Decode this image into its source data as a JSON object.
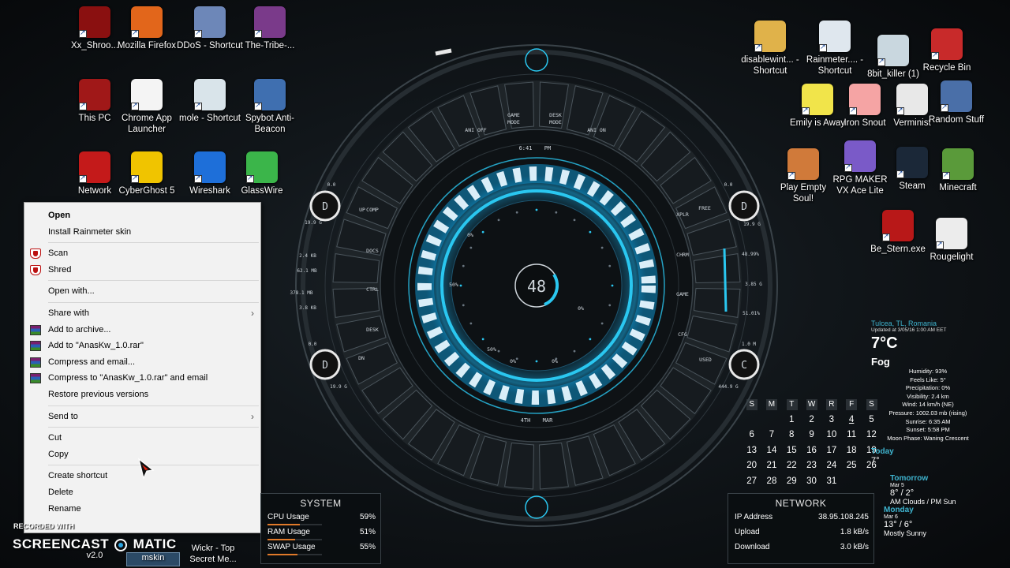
{
  "desktop_left": [
    {
      "label": "Xx_Shroo...",
      "color": "#8a1010"
    },
    {
      "label": "Mozilla Firefox",
      "color": "#e2661b"
    },
    {
      "label": "DDoS - Shortcut",
      "color": "#6d87b8"
    },
    {
      "label": "The-Tribe-...",
      "color": "#7a3a8a"
    },
    {
      "label": "This PC",
      "color": "#a01818"
    },
    {
      "label": "Chrome App Launcher",
      "color": "#f4f4f4"
    },
    {
      "label": "mole - Shortcut",
      "color": "#d9e4ea"
    },
    {
      "label": "Spybot Anti-Beacon",
      "color": "#3f6fb0"
    },
    {
      "label": "Network",
      "color": "#c41a1a"
    },
    {
      "label": "CyberGhost 5",
      "color": "#f0c400"
    },
    {
      "label": "Wireshark",
      "color": "#1e6fd9"
    },
    {
      "label": "GlassWire",
      "color": "#3bb54a"
    }
  ],
  "desktop_right": [
    {
      "label": "disablewint... - Shortcut",
      "color": "#e0b24a"
    },
    {
      "label": "Rainmeter.... - Shortcut",
      "color": "#dfe7ee"
    },
    {
      "label": "8bit_killer (1)",
      "color": "#c9d7df"
    },
    {
      "label": "Recycle Bin",
      "color": "#c82a2a"
    },
    {
      "label": "Emily is Away",
      "color": "#f1e44a"
    },
    {
      "label": "Iron Snout",
      "color": "#f5a4a4"
    },
    {
      "label": "Verminist",
      "color": "#e8e8e8"
    },
    {
      "label": "Random Stuff",
      "color": "#4a6fa8"
    },
    {
      "label": "Play Empty Soul!",
      "color": "#d07a3a"
    },
    {
      "label": "RPG MAKER VX Ace Lite",
      "color": "#7a5ac8"
    },
    {
      "label": "Steam",
      "color": "#1b2838"
    },
    {
      "label": "Minecraft",
      "color": "#5a9a3a"
    },
    {
      "label": "Be_Stern.exe",
      "color": "#b81818"
    },
    {
      "label": "Rougelight",
      "color": "#ececec"
    }
  ],
  "context_menu": {
    "open": "Open",
    "install_skin": "Install Rainmeter skin",
    "scan": "Scan",
    "shred": "Shred",
    "open_with": "Open with...",
    "share_with": "Share with",
    "add_archive": "Add to archive...",
    "add_rar": "Add to \"AnasKw_1.0.rar\"",
    "compress_email": "Compress and email...",
    "compress_rar_email": "Compress to \"AnasKw_1.0.rar\" and email",
    "restore": "Restore previous versions",
    "send_to": "Send to",
    "cut": "Cut",
    "copy": "Copy",
    "create_shortcut": "Create shortcut",
    "delete": "Delete",
    "rename": "Rename"
  },
  "hud": {
    "center_value": "48",
    "time": "6:41",
    "ampm": "PM",
    "date_day": "4TH",
    "date_month": "MAR",
    "top_buttons": [
      "ANI OFF",
      "GAME MODE",
      "DESK MODE",
      "ANI ON"
    ],
    "left_buttons": [
      "COMP",
      "DOCS",
      "CTRL",
      "DESK"
    ],
    "right_buttons": [
      "XPLR",
      "CHRM",
      "GAME",
      "CFG"
    ],
    "left_up": "UP",
    "left_dn": "DN",
    "right_free": "FREE",
    "right_used": "USED",
    "left_drive1": "D",
    "left_drive2": "D",
    "right_drive1": "D",
    "right_drive2": "C",
    "left_stats": [
      "0.0",
      "19.9 G",
      "2.4 KB",
      "62.1 MB",
      "378.1 MB",
      "3.8 KB",
      "0.0",
      "19.9 G"
    ],
    "right_stats": [
      "0.0",
      "19.9 G",
      "48.99%",
      "3.85 G",
      "51.01%",
      "1.0 M",
      "444.9 G"
    ],
    "percent_marks": [
      "0%",
      "50%",
      "0%",
      "50%",
      "0%",
      "0%"
    ],
    "colors": {
      "accent": "#2ac7f0",
      "ring": "#1a9fd8"
    }
  },
  "system_panel": {
    "title": "SYSTEM",
    "rows": [
      {
        "label": "CPU Usage",
        "value": "59%",
        "fill": 0.59
      },
      {
        "label": "RAM Usage",
        "value": "51%",
        "fill": 0.51
      },
      {
        "label": "SWAP Usage",
        "value": "55%",
        "fill": 0.55
      }
    ]
  },
  "network_panel": {
    "title": "NETWORK",
    "rows": [
      {
        "label": "IP Address",
        "value": "38.95.108.245"
      },
      {
        "label": "Upload",
        "value": "1.8 kB/s"
      },
      {
        "label": "Download",
        "value": "3.0 kB/s"
      }
    ]
  },
  "calendar": {
    "days": [
      "S",
      "M",
      "T",
      "W",
      "R",
      "F",
      "S"
    ],
    "weeks": [
      [
        "",
        "",
        "1",
        "2",
        "3",
        "4",
        "5"
      ],
      [
        "6",
        "7",
        "8",
        "9",
        "10",
        "11",
        "12"
      ],
      [
        "13",
        "14",
        "15",
        "16",
        "17",
        "18",
        "19"
      ],
      [
        "20",
        "21",
        "22",
        "23",
        "24",
        "25",
        "26"
      ],
      [
        "27",
        "28",
        "29",
        "30",
        "31",
        "",
        ""
      ]
    ],
    "today": "4"
  },
  "weather": {
    "location": "Tulcea, TL, Romania",
    "updated": "Updated at 3/05/16 1:00 AM EET",
    "temp": "7°C",
    "condition": "Fog",
    "details": [
      "Humidity: 93%",
      "Feels Like: 5°",
      "Precipitation: 0%",
      "Visibility: 2.4 km",
      "Wind: 14 km/h (NE)",
      "Pressure: 1002.03 mb (rising)",
      "Sunrise: 6:35 AM",
      "Sunset: 5:58 PM",
      "Moon Phase: Waning Crescent"
    ],
    "today_label": "Today",
    "today_temp": "7°",
    "tomorrow_label": "Tomorrow",
    "tomorrow_date": "Mar 5",
    "tomorrow_temp": "8° / 2°",
    "tomorrow_cond": "AM Clouds / PM Sun",
    "monday_label": "Monday",
    "monday_date": "Mar 6",
    "monday_temp": "13° / 6°",
    "monday_cond": "Mostly Sunny"
  },
  "watermark": {
    "line1": "RECORDED WITH",
    "line2": "SCREENCAST",
    "line3": "MATIC"
  },
  "bottom_labels": {
    "v20": "v2.0",
    "mskin": "mskin",
    "wickr": "Wickr - Top Secret Me..."
  }
}
